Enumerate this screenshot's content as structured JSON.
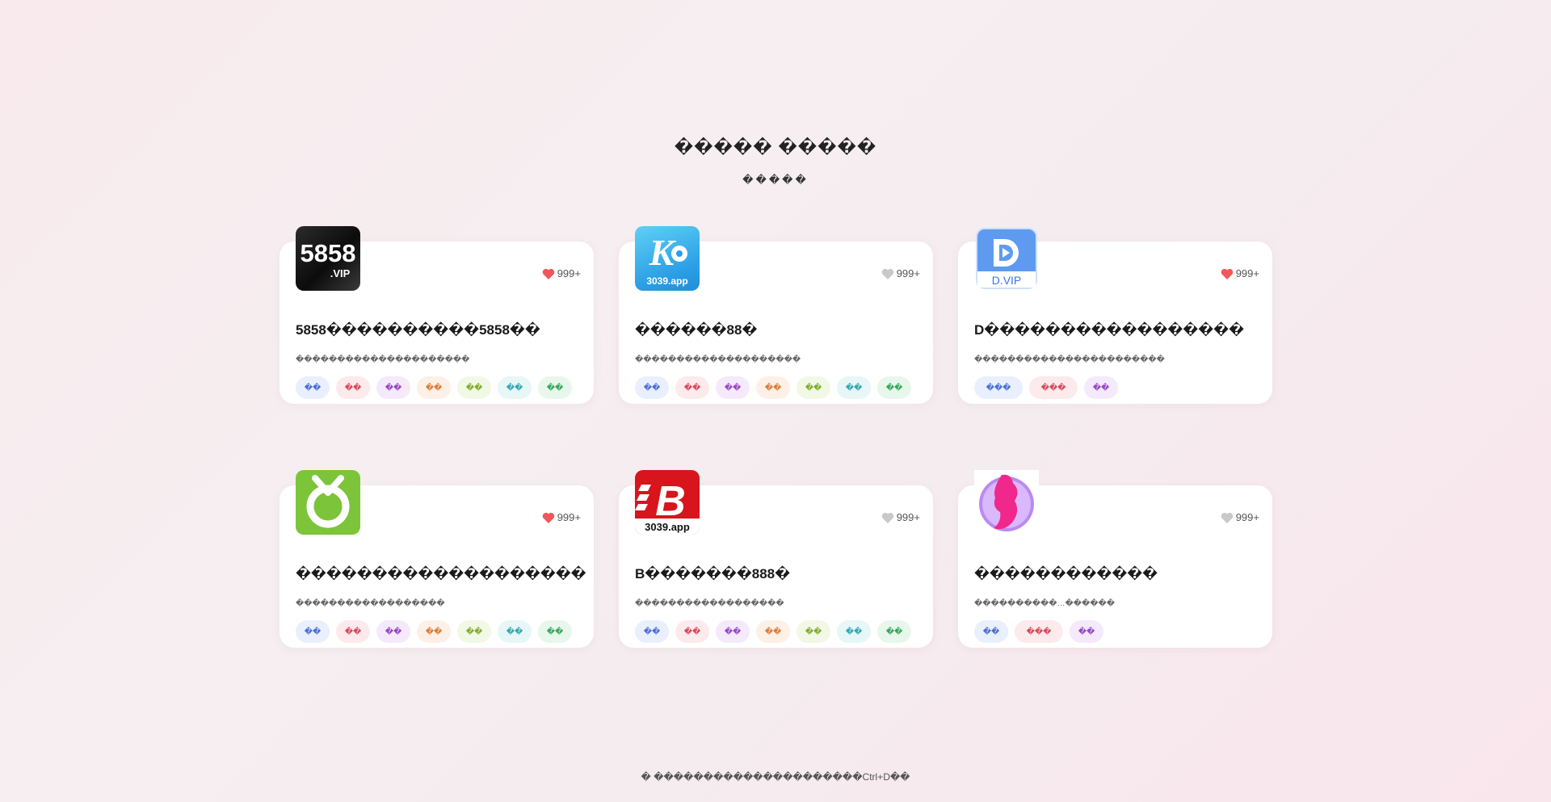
{
  "header": {
    "title": "����� �����",
    "subtitle": "�����"
  },
  "apps": [
    {
      "name": "5858����������5858��",
      "desc": "���������������������",
      "likes": "999+",
      "liked": true,
      "icon": "5858-vip-logo",
      "icon_text": "5858",
      "icon_sub": ".VIP",
      "tags": [
        "��",
        "��",
        "��",
        "��",
        "��",
        "��",
        "��"
      ]
    },
    {
      "name": "������88�",
      "desc": "��������������������",
      "likes": "999+",
      "liked": false,
      "icon": "k-3039-app-logo",
      "icon_text": "K",
      "icon_sub": "3039.app",
      "tags": [
        "��",
        "��",
        "��",
        "��",
        "��",
        "��",
        "��"
      ]
    },
    {
      "name": "D�����������������",
      "desc": "�����������������������",
      "likes": "999+",
      "liked": true,
      "icon": "d-vip-logo",
      "icon_text": "D",
      "icon_sub": "D.VIP",
      "tags": [
        "���",
        "���",
        "��"
      ]
    },
    {
      "name": "�������������������",
      "desc": "������������������",
      "likes": "999+",
      "liked": true,
      "icon": "green-ring-logo",
      "icon_text": "",
      "icon_sub": "",
      "tags": [
        "��",
        "��",
        "��",
        "��",
        "��",
        "��",
        "��"
      ]
    },
    {
      "name": "B�������888�",
      "desc": "������������������",
      "likes": "999+",
      "liked": false,
      "icon": "b-3039-app-logo",
      "icon_text": "B",
      "icon_sub": "3039.app",
      "tags": [
        "��",
        "��",
        "��",
        "��",
        "��",
        "��",
        "��"
      ]
    },
    {
      "name": "������������",
      "desc": "����������…������",
      "likes": "999+",
      "liked": false,
      "icon": "pink-silhouette-logo",
      "icon_text": "",
      "icon_sub": "",
      "tags": [
        "��",
        "���",
        "��"
      ]
    }
  ],
  "tag_palette": [
    {
      "bg": "#e9effd",
      "fg": "#4a6fd6"
    },
    {
      "bg": "#fdeaec",
      "fg": "#d9485a"
    },
    {
      "bg": "#f4eafb",
      "fg": "#9a45c9"
    },
    {
      "bg": "#fdf0e6",
      "fg": "#e07b35"
    },
    {
      "bg": "#f2f8e6",
      "fg": "#7fae2a"
    },
    {
      "bg": "#e7f6f7",
      "fg": "#2fa8b3"
    },
    {
      "bg": "#e8f7ec",
      "fg": "#35a85a"
    }
  ],
  "colors": {
    "heart_on": "#f0575b",
    "heart_off": "#c9c9c9"
  },
  "footer": {
    "text": "� ���������������������Ctrl+D��"
  }
}
